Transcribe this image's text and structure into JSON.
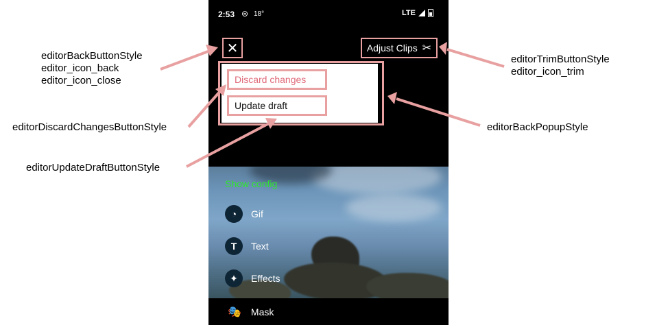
{
  "annotations": {
    "back": [
      "editorBackButtonStyle",
      "editor_icon_back",
      "editor_icon_close"
    ],
    "trim": [
      "editorTrimButtonStyle",
      "editor_icon_trim"
    ],
    "popup": "editorBackPopupStyle",
    "discard": "editorDiscardChangesButtonStyle",
    "update": "editorUpdateDraftButtonStyle"
  },
  "status_bar": {
    "time": "2:53",
    "temperature": "18°",
    "network": "LTE"
  },
  "toolbar": {
    "close_icon": "✕",
    "adjust_clips_label": "Adjust Clips",
    "scissors_icon": "✂"
  },
  "popup": {
    "discard_label": "Discard changes",
    "update_label": "Update draft"
  },
  "panel": {
    "show_config_label": "Show config",
    "tools": [
      {
        "label": "Gif",
        "icon": "sticker-icon",
        "glyph": "◔"
      },
      {
        "label": "Text",
        "icon": "text-icon",
        "glyph": "T"
      },
      {
        "label": "Effects",
        "icon": "sparkle-icon",
        "glyph": "✦"
      },
      {
        "label": "Mask",
        "icon": "mask-icon",
        "glyph": "🎭"
      }
    ]
  },
  "colors": {
    "annotation": "#e8a0a0",
    "discard_text": "#e06a7a",
    "show_config": "#2ee62e"
  }
}
